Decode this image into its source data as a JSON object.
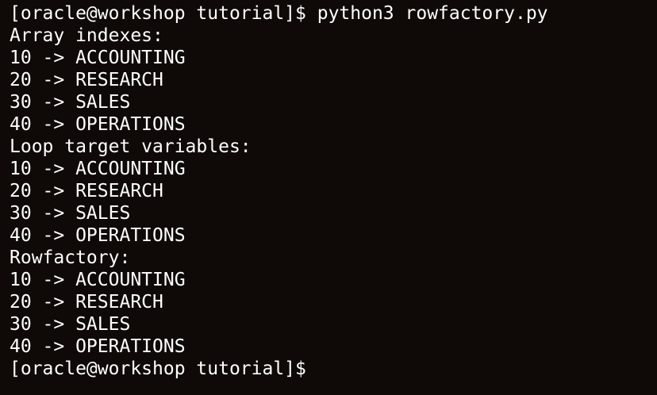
{
  "terminal": {
    "lines": [
      "[oracle@workshop tutorial]$ python3 rowfactory.py",
      "Array indexes:",
      "10 -> ACCOUNTING",
      "20 -> RESEARCH",
      "30 -> SALES",
      "40 -> OPERATIONS",
      "Loop target variables:",
      "10 -> ACCOUNTING",
      "20 -> RESEARCH",
      "30 -> SALES",
      "40 -> OPERATIONS",
      "Rowfactory:",
      "10 -> ACCOUNTING",
      "20 -> RESEARCH",
      "30 -> SALES",
      "40 -> OPERATIONS",
      "[oracle@workshop tutorial]$"
    ]
  }
}
